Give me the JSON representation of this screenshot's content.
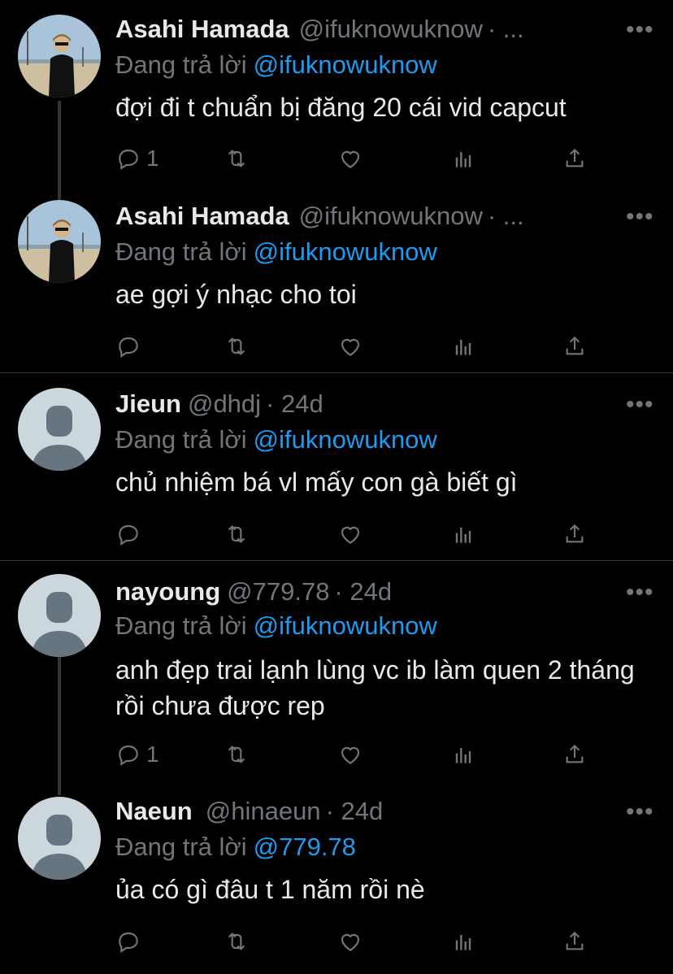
{
  "reply_prefix": "Đang trả lời",
  "more_label": "•••",
  "tweets": [
    {
      "name": "Asahi Hamada",
      "handle": "@ifuknowuknow",
      "meta": "· ...",
      "replying_to": "@ifuknowuknow",
      "text": "đợi đi t chuẩn bị đăng 20 cái vid capcut",
      "reply_count": "1",
      "avatar": "photo"
    },
    {
      "name": "Asahi Hamada",
      "handle": "@ifuknowuknow",
      "meta": "· ...",
      "replying_to": "@ifuknowuknow",
      "text": "ae gợi ý nhạc cho toi",
      "reply_count": "",
      "avatar": "photo"
    },
    {
      "name": "Jieun",
      "handle": "@dhdj",
      "meta": "· 24d",
      "replying_to": "@ifuknowuknow",
      "text": "chủ nhiệm bá vl mấy con gà biết gì",
      "reply_count": "",
      "avatar": "default"
    },
    {
      "name": "nayoung",
      "handle": "@779.78",
      "meta": "· 24d",
      "replying_to": "@ifuknowuknow",
      "text": "anh đẹp trai lạnh lùng vc ib làm quen 2 tháng rồi chưa được rep",
      "reply_count": "1",
      "avatar": "default"
    },
    {
      "name": "Naeun",
      "handle": "@hinaeun",
      "meta": "· 24d",
      "replying_to": "@779.78",
      "text": "ủa có gì đâu t 1 năm rồi nè",
      "reply_count": "",
      "avatar": "default"
    }
  ],
  "colors": {
    "background": "#000000",
    "text": "#e7e9ea",
    "secondary": "#71767b",
    "link": "#1d9bf0",
    "divider": "#2f3336"
  }
}
